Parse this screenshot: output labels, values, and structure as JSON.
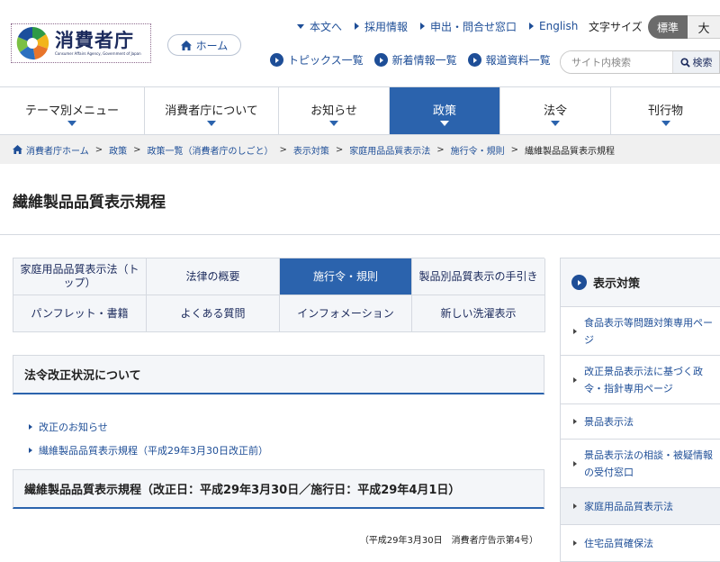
{
  "header": {
    "logo_title": "消費者庁",
    "logo_subtitle": "Consumer Affairs Agency, Government of Japan",
    "home_label": "ホーム",
    "top_links": [
      "本文へ",
      "採用情報",
      "申出・問合せ窓口",
      "English"
    ],
    "font_size_label": "文字サイズ",
    "font_size_standard": "標準",
    "font_size_large": "大",
    "sub_links": [
      "トピックス一覧",
      "新着情報一覧",
      "報道資料一覧"
    ],
    "search_placeholder": "サイト内検索",
    "search_button": "検索"
  },
  "nav": [
    "テーマ別メニュー",
    "消費者庁について",
    "お知らせ",
    "政策",
    "法令",
    "刊行物"
  ],
  "breadcrumb": [
    "消費者庁ホーム",
    "政策",
    "政策一覧（消費者庁のしごと）",
    "表示対策",
    "家庭用品品質表示法",
    "施行令・規則",
    "繊維製品品質表示規程"
  ],
  "page_title": "繊維製品品質表示規程",
  "tabs": [
    "家庭用品品質表示法（トップ）",
    "法律の概要",
    "施行令・規則",
    "製品別品質表示の手引き",
    "パンフレット・書籍",
    "よくある質問",
    "インフォメーション",
    "新しい洗濯表示"
  ],
  "section1_title": "法令改正状況について",
  "section1_links": [
    "改正のお知らせ",
    "繊維製品品質表示規程（平成29年3月30日改正前）"
  ],
  "section2_title": "繊維製品品質表示規程（改正日：平成29年3月30日／施行日：平成29年4月1日）",
  "notice": "（平成29年3月30日　消費者庁告示第4号）",
  "sidebar": {
    "title": "表示対策",
    "items": [
      "食品表示等問題対策専用ページ",
      "改正景品表示法に基づく政令・指針専用ページ",
      "景品表示法",
      "景品表示法の相談・被疑情報の受付窓口",
      "家庭用品品質表示法",
      "住宅品質確保法"
    ]
  },
  "colors": {
    "accent": "#2b63ad",
    "link": "#1e4e97",
    "logo_navy": "#1b2a5c"
  },
  "icons": [
    "logo-mark",
    "home-icon",
    "search-icon"
  ]
}
